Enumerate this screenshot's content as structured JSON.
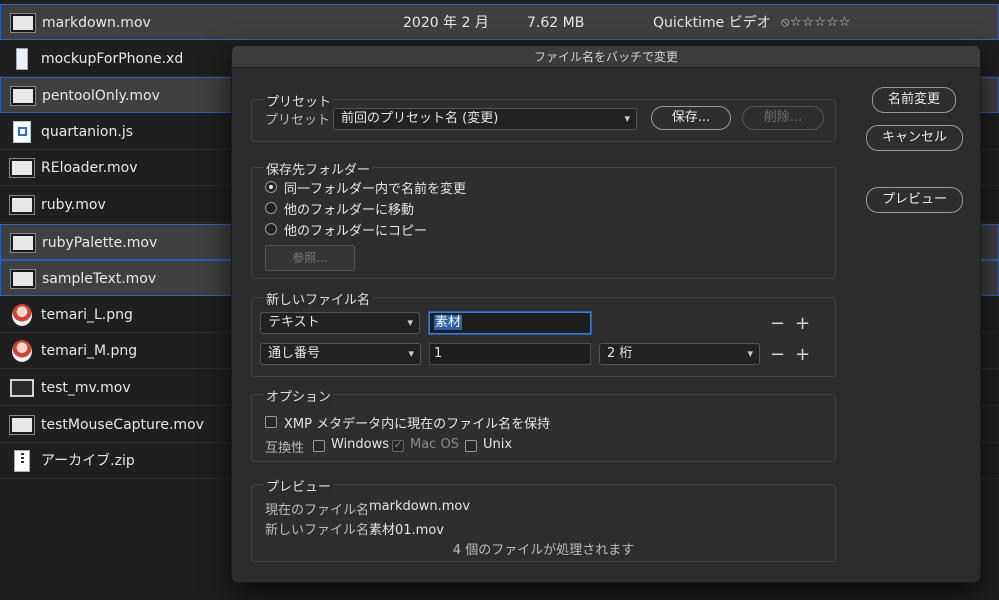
{
  "files": [
    {
      "name": "markdown.mov",
      "thumb": "video-thumbnail",
      "date": "2020 年 2 月",
      "size": "7.62 MB",
      "type": "Quicktime ビデオ",
      "rating": "⦸☆☆☆☆☆",
      "selected": true
    },
    {
      "name": "mockupForPhone.xd",
      "thumb": "document-thumbnail",
      "selected": false
    },
    {
      "name": "pentoolOnly.mov",
      "thumb": "video-thumbnail",
      "selected": true
    },
    {
      "name": "quartanion.js",
      "thumb": "js-file-icon",
      "selected": false
    },
    {
      "name": "REloader.mov",
      "thumb": "video-thumbnail",
      "selected": false
    },
    {
      "name": "ruby.mov",
      "thumb": "video-thumbnail",
      "selected": false
    },
    {
      "name": "rubyPalette.mov",
      "thumb": "video-thumbnail",
      "selected": true
    },
    {
      "name": "sampleText.mov",
      "thumb": "video-thumbnail",
      "selected": true
    },
    {
      "name": "temari_L.png",
      "thumb": "image-thumbnail",
      "selected": false
    },
    {
      "name": "temari_M.png",
      "thumb": "image-thumbnail",
      "selected": false
    },
    {
      "name": "test_mv.mov",
      "thumb": "video-thumbnail",
      "selected": false
    },
    {
      "name": "testMouseCapture.mov",
      "thumb": "video-thumbnail",
      "selected": false
    },
    {
      "name": "アーカイブ.zip",
      "thumb": "zip-file-icon",
      "selected": false
    }
  ],
  "dialog": {
    "title": "ファイル名をバッチで変更",
    "preset": {
      "group_label": "プリセット",
      "field_label": "プリセット",
      "selected": "前回のプリセット名 (変更)",
      "save": "保存...",
      "delete": "削除..."
    },
    "destination": {
      "group_label": "保存先フォルダー",
      "options": [
        "同一フォルダー内で名前を変更",
        "他のフォルダーに移動",
        "他のフォルダーにコピー"
      ],
      "selected_index": 0,
      "browse": "参照..."
    },
    "new_name": {
      "group_label": "新しいファイル名",
      "row1": {
        "type": "テキスト",
        "value": "素材"
      },
      "row2": {
        "type": "通し番号",
        "value": "1",
        "digits": "2 桁"
      },
      "minus": "−",
      "plus": "+"
    },
    "options": {
      "group_label": "オプション",
      "keep_xmp": "XMP メタデータ内に現在のファイル名を保持",
      "keep_xmp_checked": false,
      "compat_label": "互換性",
      "windows": "Windows",
      "macos": "Mac OS",
      "unix": "Unix",
      "windows_checked": false,
      "macos_checked": true,
      "unix_checked": false
    },
    "preview": {
      "group_label": "プレビュー",
      "current_label": "現在のファイル名",
      "current_value": "markdown.mov",
      "new_label": "新しいファイル名",
      "new_value": "素材01.mov",
      "summary": "4 個のファイルが処理されます"
    },
    "buttons": {
      "rename": "名前変更",
      "cancel": "キャンセル",
      "preview": "プレビュー"
    }
  },
  "icons": {
    "dropdown": "▾"
  }
}
